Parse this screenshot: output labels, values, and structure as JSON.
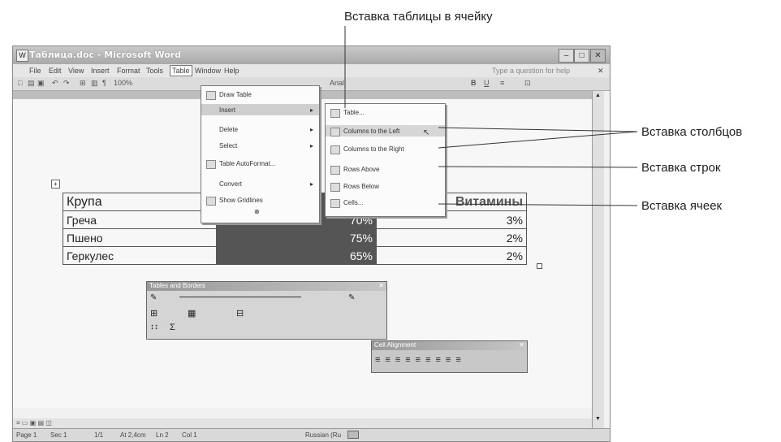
{
  "callouts": {
    "insert_table_in_cell": "Вставка таблицы в ячейку",
    "insert_columns": "Вставка столбцов",
    "insert_rows": "Вставка строк",
    "insert_cells": "Вставка ячеек"
  },
  "window": {
    "title": "Таблица.doc - Microsoft Word",
    "help_placeholder": "Type a question for help",
    "zoom": "100%",
    "font_name": "Arial"
  },
  "menubar": [
    "File",
    "Edit",
    "View",
    "Insert",
    "Format",
    "Tools",
    "Table",
    "Window",
    "Help"
  ],
  "table_menu": {
    "items": [
      "Draw Table",
      "Insert",
      "Delete",
      "Select",
      "Table AutoFormat...",
      "Convert",
      "Show Gridlines"
    ]
  },
  "insert_submenu": {
    "items": [
      "Table...",
      "Columns to the Left",
      "Columns to the Right",
      "Rows Above",
      "Rows Below",
      "Cells..."
    ]
  },
  "doc_table": {
    "header": [
      "Крупа",
      "",
      "Витамины"
    ],
    "rows": [
      [
        "Греча",
        "70%",
        "3%"
      ],
      [
        "Пшено",
        "75%",
        "2%"
      ],
      [
        "Геркулес",
        "65%",
        "2%"
      ]
    ]
  },
  "toolbars": {
    "tables_and_borders": "Tables and Borders",
    "cell_alignment": "Cell Alignment"
  },
  "statusbar": {
    "page": "Page 1",
    "sec": "Sec 1",
    "pages": "1/1",
    "at": "At 2,4cm",
    "ln": "Ln 2",
    "col": "Col 1",
    "language": "Russian (Ru"
  }
}
